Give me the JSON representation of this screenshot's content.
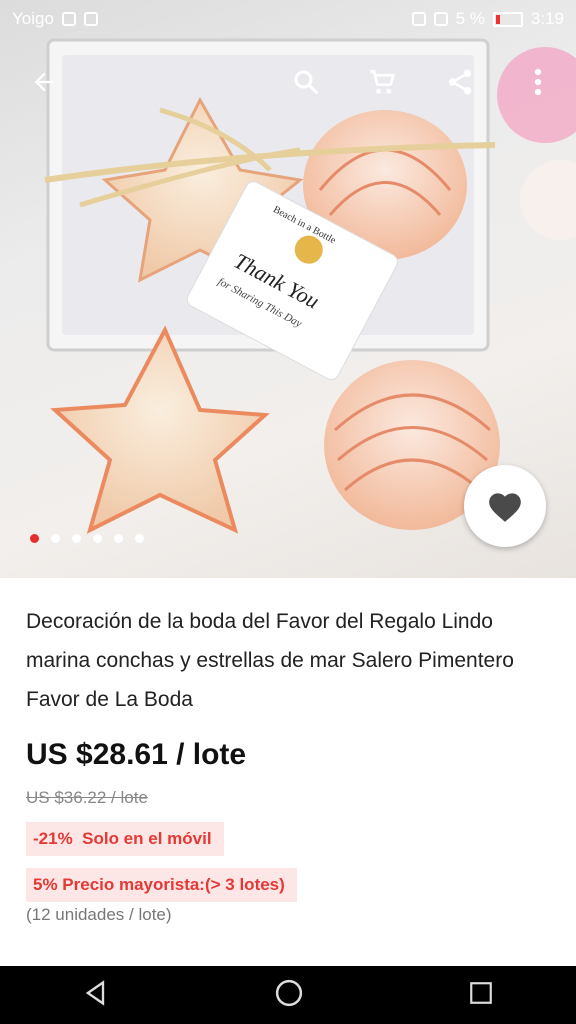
{
  "status_bar": {
    "carrier": "Yoigo",
    "battery": "5 %",
    "time": "3:19"
  },
  "top_bar": {
    "icons": [
      "back-arrow-icon",
      "search-icon",
      "cart-icon",
      "share-icon",
      "more-vert-icon"
    ]
  },
  "gallery": {
    "total_images": 6,
    "active_index": 0,
    "tag_text_top": "Beach in a Bottle",
    "tag_text_main": "Thank You",
    "tag_text_sub": "for Sharing This Day"
  },
  "product": {
    "title": "Decoración de la boda del Favor del Regalo Lindo marina conchas y estrellas de mar Salero Pimentero Favor de La Boda",
    "price": "US $28.61 / lote",
    "original_price": "US $36.22 / lote",
    "discount_badge": "-21%  Solo en el móvil",
    "wholesale_badge": "5% Precio mayorista:(> 3 lotes)",
    "units": "(12 unidades / lote)"
  },
  "colors": {
    "accent_red": "#e53935",
    "badge_bg": "#fde6e6"
  },
  "nav_bar": {
    "icons": [
      "back-triangle-icon",
      "home-circle-icon",
      "recents-square-icon"
    ]
  }
}
